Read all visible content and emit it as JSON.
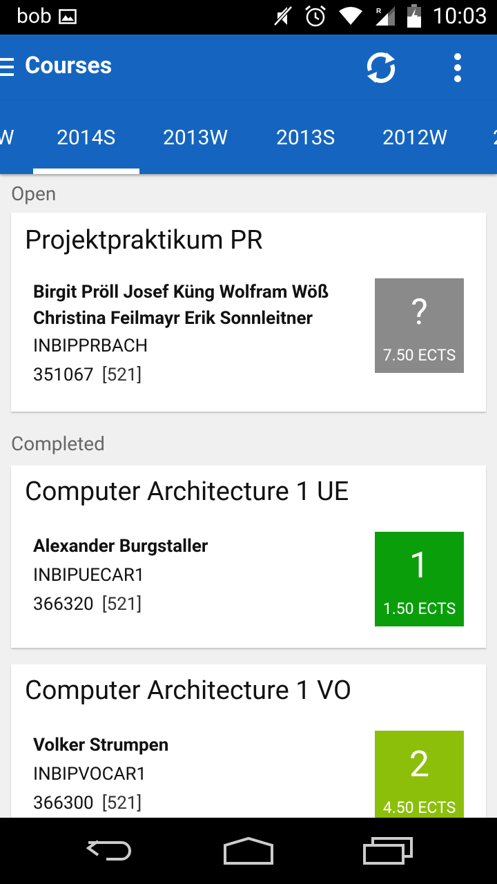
{
  "status_bar": {
    "user": "bob",
    "time": "10:03"
  },
  "app_bar": {
    "title": "Courses"
  },
  "tabs": [
    "W",
    "2014S",
    "2013W",
    "2013S",
    "2012W",
    "2"
  ],
  "sections": {
    "open_label": "Open",
    "completed_label": "Completed"
  },
  "courses": [
    {
      "title": "Projektpraktikum PR",
      "lecturers_line1": "Birgit Pröll Josef Küng Wolfram Wöß",
      "lecturers_line2": "Christina Feilmayr Erik Sonnleitner",
      "code": "INBIPPRBACH",
      "number": "351067",
      "room": "[521]",
      "grade": "?",
      "ects": "7.50 ECTS",
      "color": "#8a8a8a"
    },
    {
      "title": "Computer Architecture 1 UE",
      "lecturers_line1": "Alexander Burgstaller",
      "code": "INBIPUECAR1",
      "number": "366320",
      "room": "[521]",
      "grade": "1",
      "ects": "1.50 ECTS",
      "color": "#0b9e0b"
    },
    {
      "title": "Computer Architecture 1 VO",
      "lecturers_line1": "Volker Strumpen",
      "code": "INBIPVOCAR1",
      "number": "366300",
      "room": "[521]",
      "grade": "2",
      "ects": "4.50 ECTS",
      "color": "#8cbf0a"
    }
  ]
}
